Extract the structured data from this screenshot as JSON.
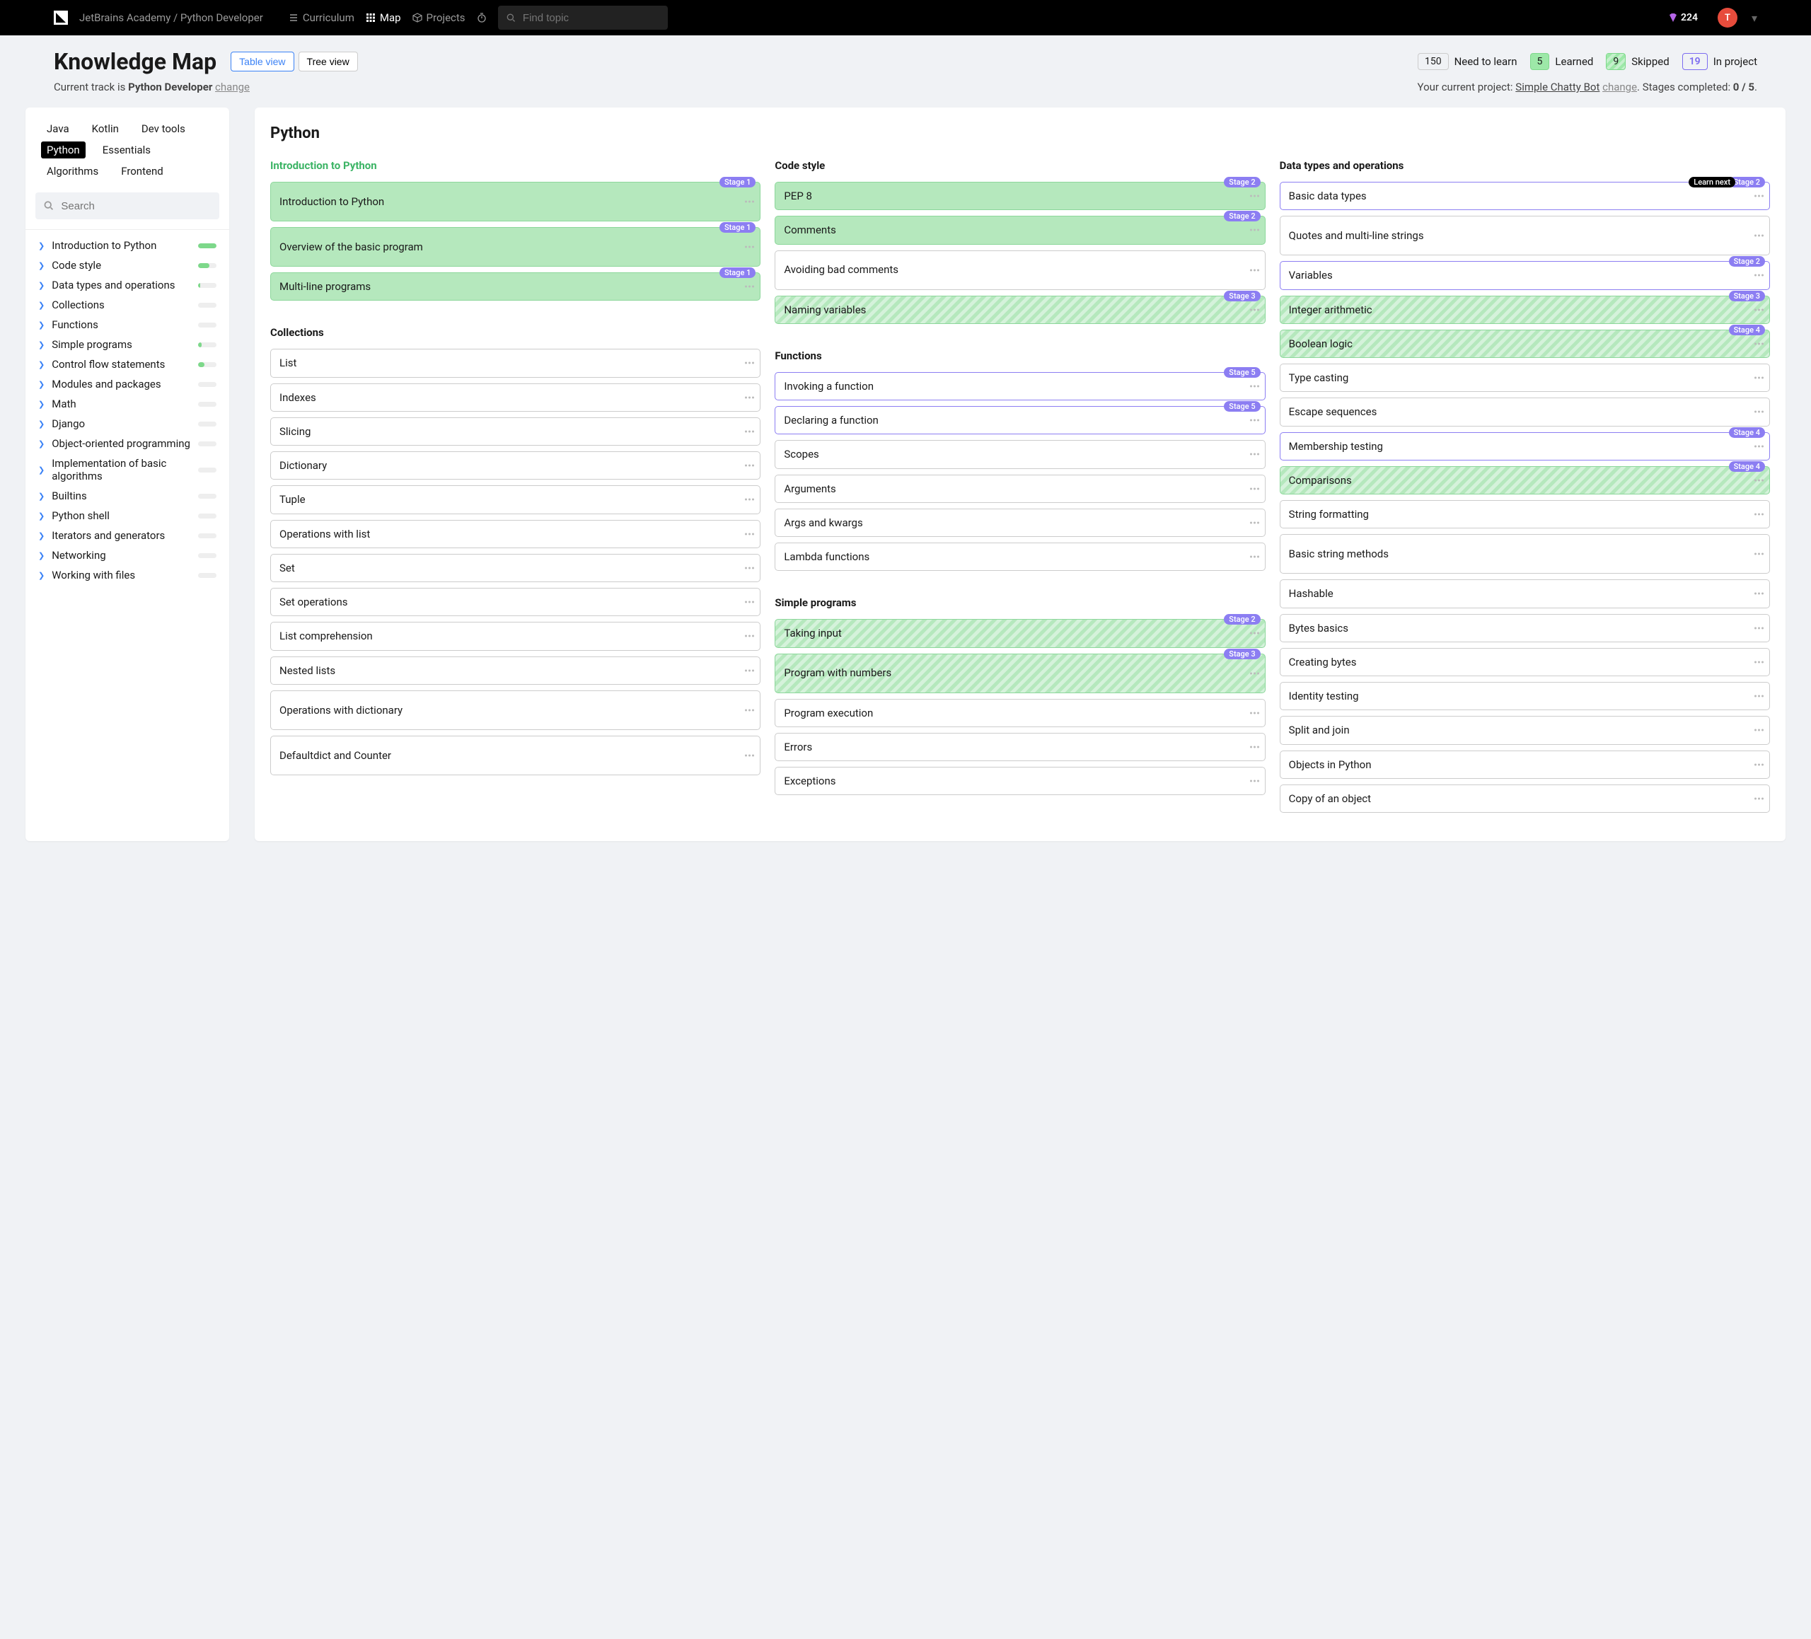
{
  "header": {
    "breadcrumb": "JetBrains Academy / Python Developer",
    "nav": {
      "curriculum": "Curriculum",
      "map": "Map",
      "projects": "Projects"
    },
    "search_placeholder": "Find topic",
    "gems": "224",
    "avatar": "T"
  },
  "subheader": {
    "title": "Knowledge Map",
    "views": {
      "table": "Table view",
      "tree": "Tree view"
    },
    "stats": {
      "learn_n": "150",
      "learn_l": "Need to learn",
      "learned_n": "5",
      "learned_l": "Learned",
      "skipped_n": "9",
      "skipped_l": "Skipped",
      "proj_n": "19",
      "proj_l": "In project"
    }
  },
  "info": {
    "track_prefix": "Current track is ",
    "track": "Python Developer",
    "change": "change",
    "proj_prefix": "Your current project: ",
    "proj": "Simple Chatty Bot",
    "stages_prefix": ". Stages completed: ",
    "stages": "0 / 5",
    "period": "."
  },
  "tabs": [
    "Java",
    "Kotlin",
    "Dev tools",
    "Python",
    "Essentials",
    "Algorithms",
    "Frontend"
  ],
  "active_tab": "Python",
  "side_search": "Search",
  "side_items": [
    {
      "label": "Introduction to Python",
      "fill": 100
    },
    {
      "label": "Code style",
      "fill": 60
    },
    {
      "label": "Data types and operations",
      "fill": 12
    },
    {
      "label": "Collections",
      "fill": 0
    },
    {
      "label": "Functions",
      "fill": 0
    },
    {
      "label": "Simple programs",
      "fill": 20
    },
    {
      "label": "Control flow statements",
      "fill": 35
    },
    {
      "label": "Modules and packages",
      "fill": 0
    },
    {
      "label": "Math",
      "fill": 0
    },
    {
      "label": "Django",
      "fill": 0
    },
    {
      "label": "Object-oriented programming",
      "fill": 0
    },
    {
      "label": "Implementation of basic algorithms",
      "fill": 0
    },
    {
      "label": "Builtins",
      "fill": 0
    },
    {
      "label": "Python shell",
      "fill": 0
    },
    {
      "label": "Iterators and generators",
      "fill": 0
    },
    {
      "label": "Networking",
      "fill": 0
    },
    {
      "label": "Working with files",
      "fill": 0
    }
  ],
  "map_title": "Python",
  "columns": [
    {
      "groups": [
        {
          "title": "Introduction to Python",
          "title_class": "green",
          "cards": [
            {
              "t": "Introduction to Python",
              "cls": "green tall",
              "stage": "Stage 1"
            },
            {
              "t": "Overview of the basic program",
              "cls": "green tall",
              "stage": "Stage 1"
            },
            {
              "t": "Multi-line programs",
              "cls": "green",
              "stage": "Stage 1"
            }
          ]
        },
        {
          "title": "Collections",
          "title_class": "spacer-above",
          "cards": [
            {
              "t": "List"
            },
            {
              "t": "Indexes"
            },
            {
              "t": "Slicing"
            },
            {
              "t": "Dictionary"
            },
            {
              "t": "Tuple"
            },
            {
              "t": "Operations with list"
            },
            {
              "t": "Set"
            },
            {
              "t": "Set operations"
            },
            {
              "t": "List comprehension"
            },
            {
              "t": "Nested lists"
            },
            {
              "t": "Operations with dictionary",
              "cls": "tall"
            },
            {
              "t": "Defaultdict and Counter",
              "cls": "tall"
            }
          ]
        }
      ]
    },
    {
      "groups": [
        {
          "title": "Code style",
          "cards": [
            {
              "t": "PEP 8",
              "cls": "green",
              "stage": "Stage 2"
            },
            {
              "t": "Comments",
              "cls": "green",
              "stage": "Stage 2"
            },
            {
              "t": "Avoiding bad comments",
              "cls": "tall"
            },
            {
              "t": "Naming variables",
              "cls": "striped",
              "stage": "Stage 3"
            }
          ]
        },
        {
          "title": "Functions",
          "title_class": "spacer-above",
          "cards": [
            {
              "t": "Invoking a function",
              "cls": "outlined",
              "stage": "Stage 5"
            },
            {
              "t": "Declaring a function",
              "cls": "outlined",
              "stage": "Stage 5"
            },
            {
              "t": "Scopes"
            },
            {
              "t": "Arguments"
            },
            {
              "t": "Args and kwargs"
            },
            {
              "t": "Lambda functions"
            }
          ]
        },
        {
          "title": "Simple programs",
          "title_class": "spacer-above",
          "cards": [
            {
              "t": "Taking input",
              "cls": "striped",
              "stage": "Stage 2"
            },
            {
              "t": "Program with numbers",
              "cls": "striped tall",
              "stage": "Stage 3"
            },
            {
              "t": "Program execution"
            },
            {
              "t": "Errors"
            },
            {
              "t": "Exceptions"
            }
          ]
        }
      ]
    },
    {
      "groups": [
        {
          "title": "Data types and operations",
          "cards": [
            {
              "t": "Basic data types",
              "cls": "outlined",
              "stage": "Stage 2",
              "learn": "Learn next"
            },
            {
              "t": "Quotes and multi-line strings",
              "cls": "tall"
            },
            {
              "t": "Variables",
              "cls": "outlined",
              "stage": "Stage 2"
            },
            {
              "t": "Integer arithmetic",
              "cls": "striped",
              "stage": "Stage 3"
            },
            {
              "t": "Boolean logic",
              "cls": "striped",
              "stage": "Stage 4"
            },
            {
              "t": "Type casting"
            },
            {
              "t": "Escape sequences"
            },
            {
              "t": "Membership testing",
              "cls": "outlined",
              "stage": "Stage 4"
            },
            {
              "t": "Comparisons",
              "cls": "striped",
              "stage": "Stage 4"
            },
            {
              "t": "String formatting"
            },
            {
              "t": "Basic string methods",
              "cls": "tall"
            },
            {
              "t": "Hashable"
            },
            {
              "t": "Bytes basics"
            },
            {
              "t": "Creating bytes"
            },
            {
              "t": "Identity testing"
            },
            {
              "t": "Split and join"
            },
            {
              "t": "Objects in Python"
            },
            {
              "t": "Copy of an object"
            }
          ]
        }
      ]
    }
  ]
}
